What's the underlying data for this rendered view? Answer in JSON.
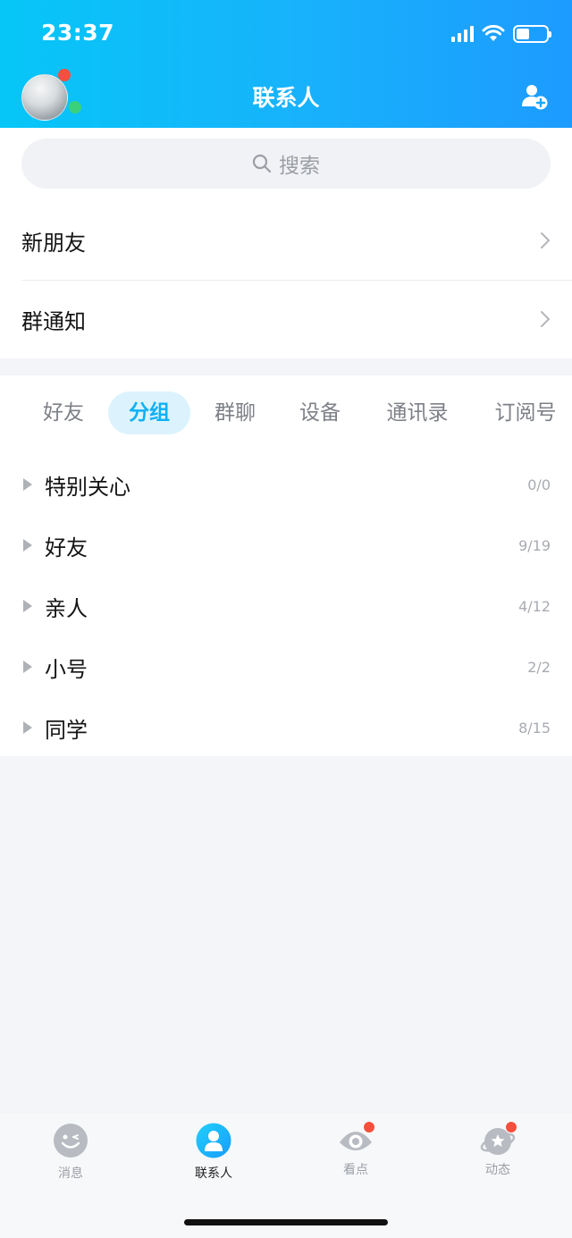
{
  "status_bar": {
    "time": "23:37"
  },
  "header": {
    "title": "联系人"
  },
  "search": {
    "placeholder": "搜索"
  },
  "entries": [
    {
      "label": "新朋友"
    },
    {
      "label": "群通知"
    }
  ],
  "tabs": [
    {
      "label": "好友",
      "active": false
    },
    {
      "label": "分组",
      "active": true
    },
    {
      "label": "群聊",
      "active": false
    },
    {
      "label": "设备",
      "active": false
    },
    {
      "label": "通讯录",
      "active": false
    },
    {
      "label": "订阅号",
      "active": false
    }
  ],
  "groups": [
    {
      "name": "特别关心",
      "count": "0/0"
    },
    {
      "name": "好友",
      "count": "9/19"
    },
    {
      "name": "亲人",
      "count": "4/12"
    },
    {
      "name": "小号",
      "count": "2/2"
    },
    {
      "name": "同学",
      "count": "8/15"
    }
  ],
  "tabbar": [
    {
      "label": "消息",
      "icon": "message-smile-icon",
      "active": false,
      "badge": false
    },
    {
      "label": "联系人",
      "icon": "contact-person-icon",
      "active": true,
      "badge": false
    },
    {
      "label": "看点",
      "icon": "eye-icon",
      "active": false,
      "badge": true
    },
    {
      "label": "动态",
      "icon": "planet-star-icon",
      "active": false,
      "badge": true
    }
  ],
  "colors": {
    "accent": "#0fb0f5",
    "header_start": "#06c6f7",
    "header_end": "#1d9bff",
    "badge": "#f5503d"
  }
}
